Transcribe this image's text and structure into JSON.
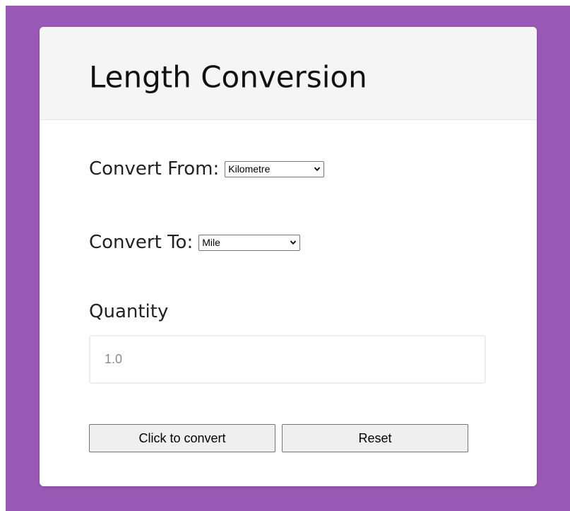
{
  "colors": {
    "page_background": "#9b59b6",
    "card_background": "#ffffff",
    "header_background": "#f5f5f5",
    "button_background": "#efefef"
  },
  "card": {
    "title": "Length Conversion"
  },
  "form": {
    "from_label": "Convert From:",
    "from_selected": "Kilometre",
    "to_label": "Convert To:",
    "to_selected": "Mile",
    "quantity_label": "Quantity",
    "quantity_placeholder": "1.0"
  },
  "buttons": {
    "convert_label": "Click to convert",
    "reset_label": "Reset"
  },
  "icons": {
    "dropdown": "chevron-down-icon"
  }
}
